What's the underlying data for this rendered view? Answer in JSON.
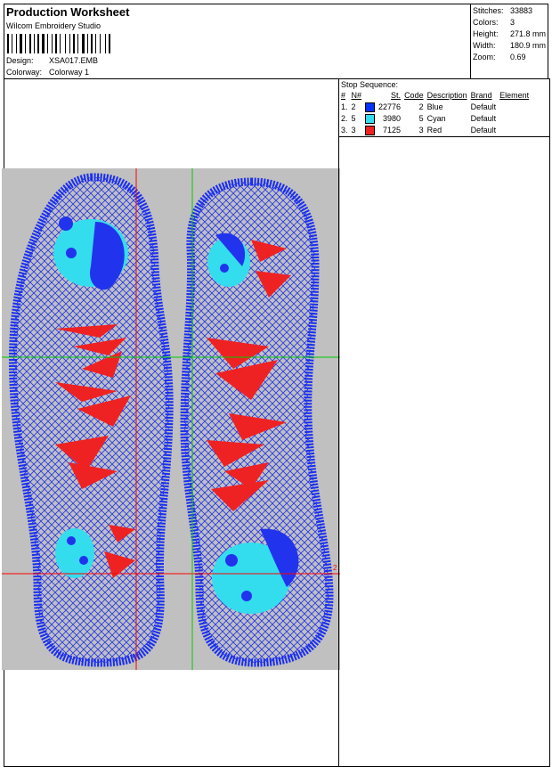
{
  "header": {
    "title": "Production Worksheet",
    "software": "Wilcom Embroidery Studio",
    "design_label": "Design:",
    "design_value": "XSA017.EMB",
    "colorway_label": "Colorway:",
    "colorway_value": "Colorway 1"
  },
  "stats": [
    {
      "label": "Stitches:",
      "value": "33883"
    },
    {
      "label": "Colors:",
      "value": "3"
    },
    {
      "label": "Height:",
      "value": "271.8 mm"
    },
    {
      "label": "Width:",
      "value": "180.9 mm"
    },
    {
      "label": "Zoom:",
      "value": "0.69"
    }
  ],
  "stop_sequence": {
    "title": "Stop Sequence:",
    "headers": [
      "#",
      "N#",
      "St.",
      "Code",
      "Description",
      "Brand",
      "Element"
    ],
    "rows": [
      {
        "num": "1.",
        "n": "2",
        "color": "#0033ff",
        "stitches": "22776",
        "code": "2",
        "description": "Blue",
        "brand": "Default",
        "element": ""
      },
      {
        "num": "2.",
        "n": "5",
        "color": "#33ddee",
        "stitches": "3980",
        "code": "5",
        "description": "Cyan",
        "brand": "Default",
        "element": ""
      },
      {
        "num": "3.",
        "n": "3",
        "color": "#ee2222",
        "stitches": "7125",
        "code": "3",
        "description": "Red",
        "brand": "Default",
        "element": ""
      }
    ]
  },
  "design_canvas": {
    "background": "#c0c0c0",
    "marker_label": "2"
  }
}
